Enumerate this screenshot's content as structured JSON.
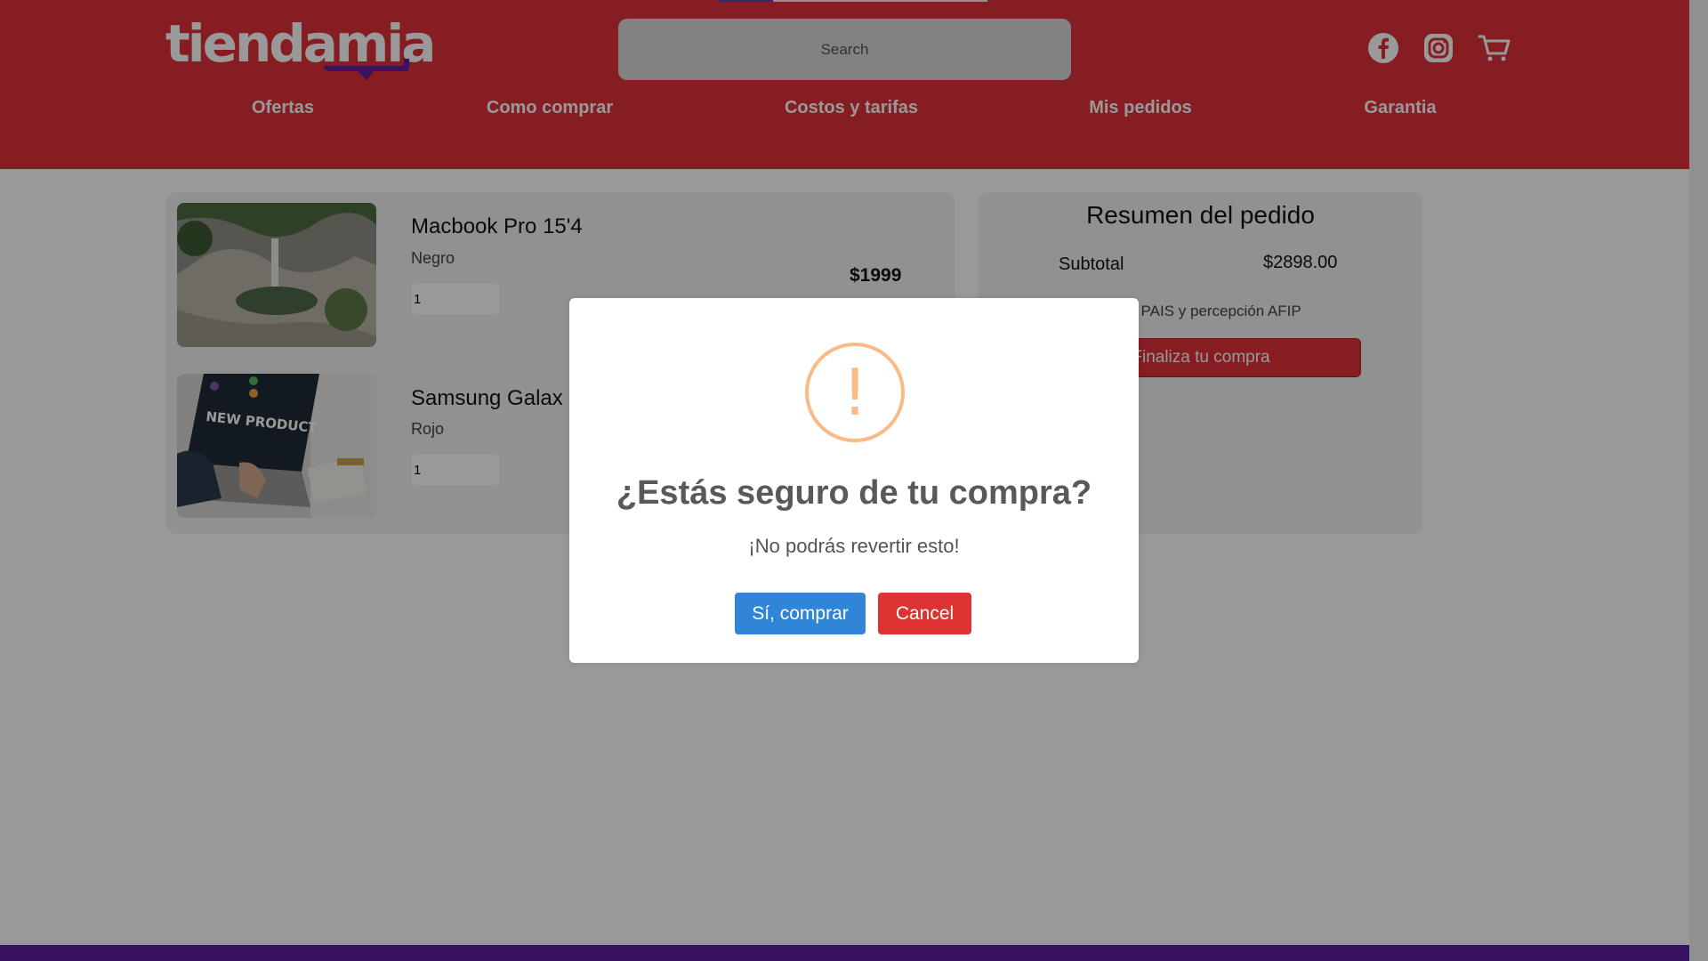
{
  "header": {
    "logo_text": "tiendamia",
    "search_placeholder": "Search",
    "icons": [
      "facebook-icon",
      "instagram-icon",
      "cart-icon"
    ]
  },
  "nav": {
    "items": [
      {
        "label": "Ofertas"
      },
      {
        "label": "Como comprar"
      },
      {
        "label": "Costos y tarifas"
      },
      {
        "label": "Mis pedidos"
      },
      {
        "label": "Garantia"
      }
    ]
  },
  "cart": {
    "items": [
      {
        "name": "Macbook Pro 15'4",
        "color": "Negro",
        "qty": "1",
        "price": "$1999"
      },
      {
        "name": "Samsung Galax",
        "color": "Rojo",
        "qty": "1"
      }
    ]
  },
  "summary": {
    "title": "Resumen del pedido",
    "subtotal_label": "Subtotal",
    "subtotal_value": "$2898.00",
    "tax_note": "uesto PAIS y percepción AFIP",
    "checkout_label": "Finaliza tu compra"
  },
  "modal": {
    "icon": "!",
    "title": "¿Estás seguro de tu compra?",
    "text": "¡No podrás revertir esto!",
    "confirm_label": "Sí, comprar",
    "cancel_label": "Cancel"
  },
  "colors": {
    "brand_red": "#e0313a",
    "brand_purple": "#5a1fa0",
    "confirm_blue": "#3085d6",
    "cancel_red": "#dd3333",
    "warning_orange": "#f8bb86"
  }
}
